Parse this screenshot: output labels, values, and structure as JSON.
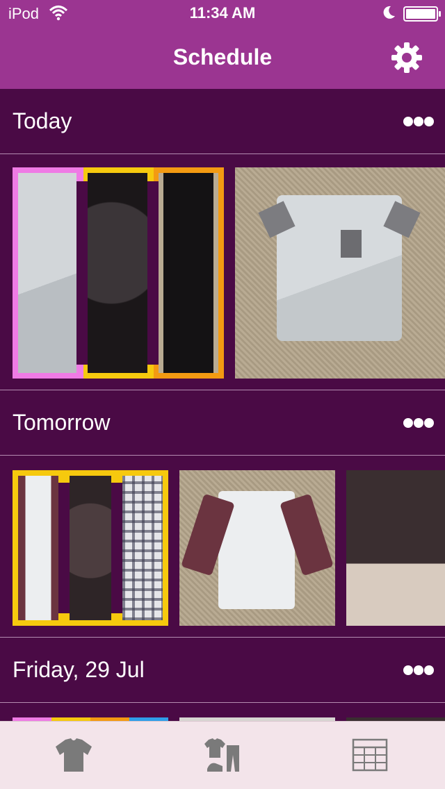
{
  "status_bar": {
    "carrier": "iPod",
    "time": "11:34 AM",
    "icons": [
      "wifi-icon",
      "moon-icon",
      "battery-icon"
    ]
  },
  "nav": {
    "title": "Schedule",
    "right_icon": "gear-icon"
  },
  "sections": [
    {
      "title": "Today",
      "menu_icon": "more-dots-icon",
      "items": [
        "outfit-pink-yellow-orange",
        "grey-t-shirt"
      ]
    },
    {
      "title": "Tomorrow",
      "menu_icon": "more-dots-icon",
      "items": [
        "outfit-yellow",
        "maroon-raglan-shirt",
        "brown-sneakers"
      ]
    },
    {
      "title": "Friday, 29 Jul",
      "menu_icon": "more-dots-icon",
      "items": [
        "outfit-multicolor"
      ]
    }
  ],
  "colors": {
    "nav_bg": "#9b3591",
    "content_bg": "#4a0a45",
    "tab_bg": "#f3e4ea",
    "pink": "#ef7be5",
    "yellow": "#f6c90e",
    "orange": "#f39a12",
    "blue": "#2f9ee8"
  },
  "tab_bar": {
    "tabs": [
      {
        "icon": "t-shirt-icon"
      },
      {
        "icon": "outfits-icon"
      },
      {
        "icon": "calendar-grid-icon"
      }
    ]
  }
}
